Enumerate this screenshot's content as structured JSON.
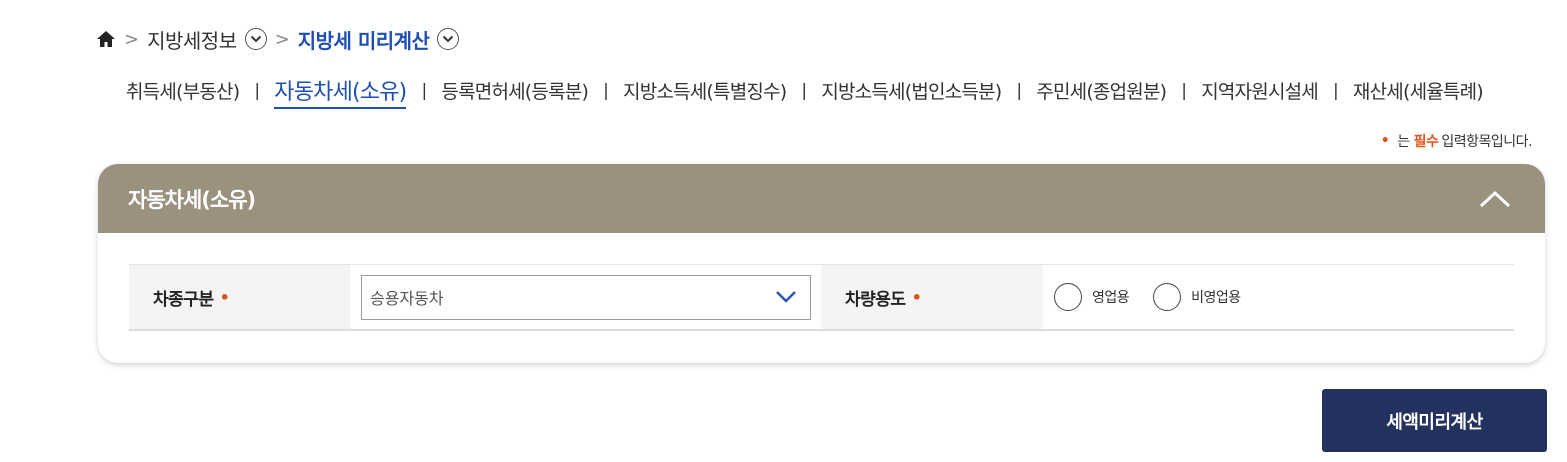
{
  "breadcrumb": {
    "home_icon": "home-icon",
    "items": [
      {
        "label": "지방세정보"
      },
      {
        "label": "지방세 미리계산"
      }
    ]
  },
  "tabs": [
    {
      "label": "취득세(부동산)",
      "active": false
    },
    {
      "label": "자동차세(소유)",
      "active": true
    },
    {
      "label": "등록면허세(등록분)",
      "active": false
    },
    {
      "label": "지방소득세(특별징수)",
      "active": false
    },
    {
      "label": "지방소득세(법인소득분)",
      "active": false
    },
    {
      "label": "주민세(종업원분)",
      "active": false
    },
    {
      "label": "지역자원시설세",
      "active": false
    },
    {
      "label": "재산세(세율특례)",
      "active": false
    }
  ],
  "tab_separator": "|",
  "required_note": {
    "marker": "•",
    "prefix": "는",
    "strong": "필수",
    "suffix": "입력항목입니다."
  },
  "panel": {
    "title": "자동차세(소유)",
    "header_color": "#9a917f"
  },
  "form": {
    "car_type": {
      "label": "차종구분",
      "required_marker": "•",
      "selected": "승용자동차"
    },
    "usage": {
      "label": "차량용도",
      "required_marker": "•",
      "options": [
        {
          "label": "영업용"
        },
        {
          "label": "비영업용"
        }
      ]
    }
  },
  "actions": {
    "calculate_label": "세액미리계산",
    "button_color": "#23315f"
  },
  "colors": {
    "accent_blue": "#1f4fb3",
    "required_orange": "#e0531f"
  }
}
